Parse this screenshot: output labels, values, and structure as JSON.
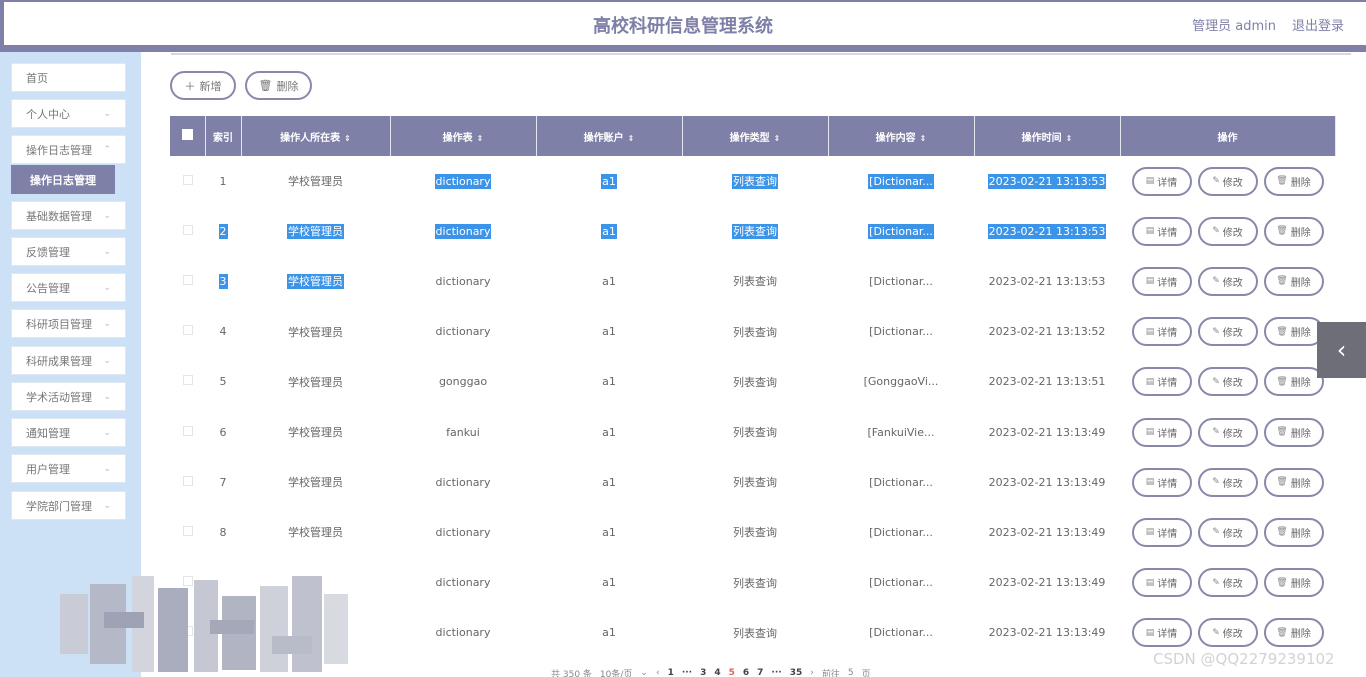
{
  "header": {
    "title": "高校科研信息管理系统",
    "user_label": "管理员 admin",
    "logout": "退出登录"
  },
  "sidebar": {
    "items": [
      {
        "label": "首页",
        "has_chevron": false
      },
      {
        "label": "个人中心",
        "has_chevron": true
      },
      {
        "label": "操作日志管理",
        "has_chevron": true
      },
      {
        "label": "基础数据管理",
        "has_chevron": true
      },
      {
        "label": "反馈管理",
        "has_chevron": true
      },
      {
        "label": "公告管理",
        "has_chevron": true
      },
      {
        "label": "科研项目管理",
        "has_chevron": true
      },
      {
        "label": "科研成果管理",
        "has_chevron": true
      },
      {
        "label": "学术活动管理",
        "has_chevron": true
      },
      {
        "label": "通知管理",
        "has_chevron": true
      },
      {
        "label": "用户管理",
        "has_chevron": true
      },
      {
        "label": "学院部门管理",
        "has_chevron": true
      }
    ],
    "active_sub": "操作日志管理"
  },
  "toolbar": {
    "add_label": "新增",
    "delete_label": "删除"
  },
  "table": {
    "columns": [
      "索引",
      "操作人所在表",
      "操作表",
      "操作账户",
      "操作类型",
      "操作内容",
      "操作时间",
      "操作"
    ],
    "rows": [
      {
        "index": "1",
        "user_table": "学校管理员",
        "table": "dictionary",
        "account": "a1",
        "type": "列表查询",
        "content": "[Dictionar...",
        "time": "2023-02-21 13:13:53"
      },
      {
        "index": "2",
        "user_table": "学校管理员",
        "table": "dictionary",
        "account": "a1",
        "type": "列表查询",
        "content": "[Dictionar...",
        "time": "2023-02-21 13:13:53"
      },
      {
        "index": "3",
        "user_table": "学校管理员",
        "table": "dictionary",
        "account": "a1",
        "type": "列表查询",
        "content": "[Dictionar...",
        "time": "2023-02-21 13:13:53"
      },
      {
        "index": "4",
        "user_table": "学校管理员",
        "table": "dictionary",
        "account": "a1",
        "type": "列表查询",
        "content": "[Dictionar...",
        "time": "2023-02-21 13:13:52"
      },
      {
        "index": "5",
        "user_table": "学校管理员",
        "table": "gonggao",
        "account": "a1",
        "type": "列表查询",
        "content": "[GonggaoVi...",
        "time": "2023-02-21 13:13:51"
      },
      {
        "index": "6",
        "user_table": "学校管理员",
        "table": "fankui",
        "account": "a1",
        "type": "列表查询",
        "content": "[FankuiVie...",
        "time": "2023-02-21 13:13:49"
      },
      {
        "index": "7",
        "user_table": "学校管理员",
        "table": "dictionary",
        "account": "a1",
        "type": "列表查询",
        "content": "[Dictionar...",
        "time": "2023-02-21 13:13:49"
      },
      {
        "index": "8",
        "user_table": "学校管理员",
        "table": "dictionary",
        "account": "a1",
        "type": "列表查询",
        "content": "[Dictionar...",
        "time": "2023-02-21 13:13:49"
      },
      {
        "index": "",
        "user_table": "",
        "table": "dictionary",
        "account": "a1",
        "type": "列表查询",
        "content": "[Dictionar...",
        "time": "2023-02-21 13:13:49"
      },
      {
        "index": "",
        "user_table": "",
        "table": "dictionary",
        "account": "a1",
        "type": "列表查询",
        "content": "[Dictionar...",
        "time": "2023-02-21 13:13:49"
      }
    ],
    "row_actions": {
      "detail": "详情",
      "edit": "修改",
      "delete": "删除"
    }
  },
  "pagination": {
    "total": "共 350 条",
    "page_size": "10条/页",
    "pages": [
      "1",
      "···",
      "3",
      "4",
      "5",
      "6",
      "7",
      "···",
      "35"
    ],
    "current_page": "5",
    "goto_label": "前往",
    "goto_value": "5",
    "page_suffix": "页"
  },
  "watermark": "CSDN @QQ2279239102",
  "colors": {
    "primary": "#7f80a8",
    "sidebar_bg": "#cde1f6",
    "selection": "#3b94e8"
  }
}
